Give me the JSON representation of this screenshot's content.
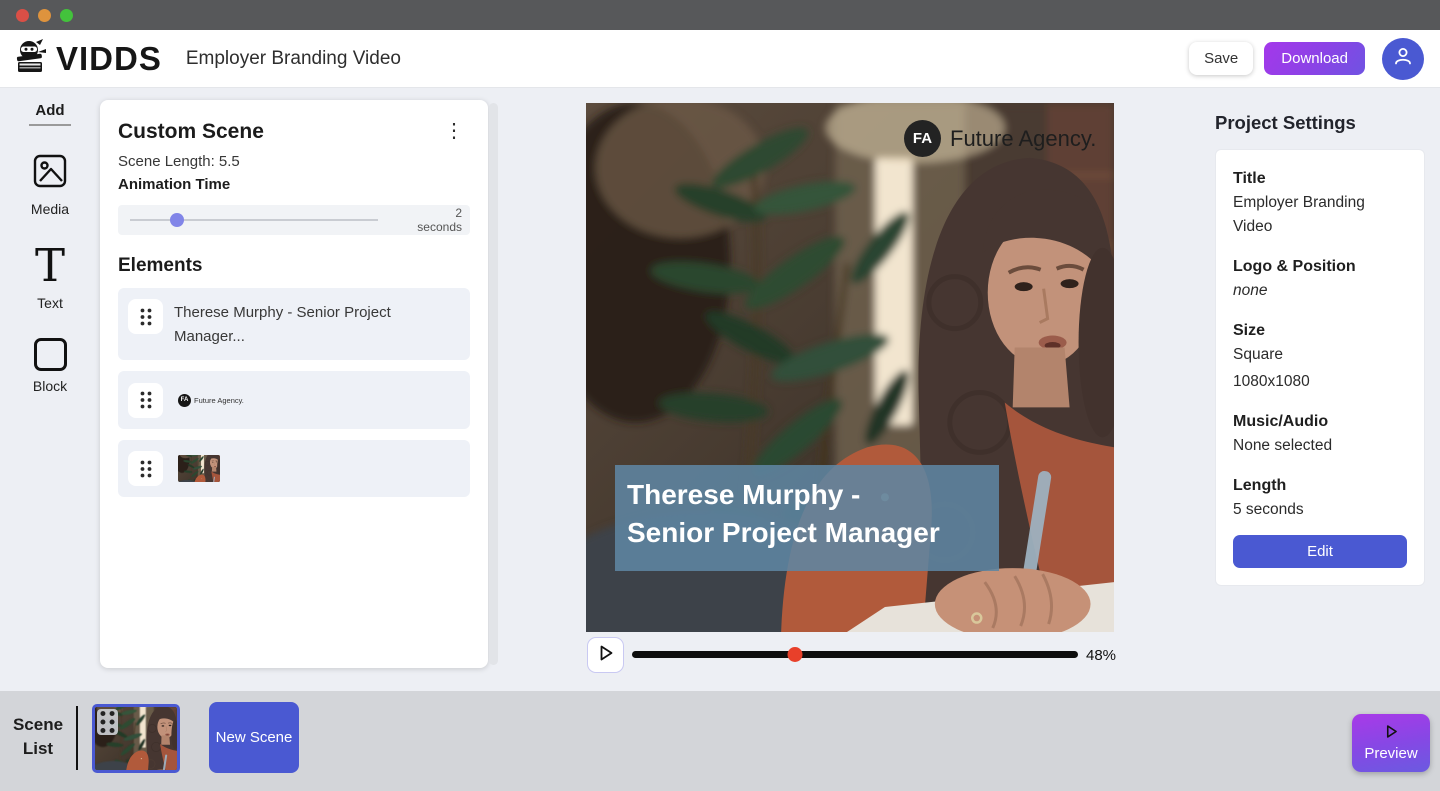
{
  "header": {
    "logo_text": "VIDDS",
    "project_title": "Employer Branding Video",
    "save_label": "Save",
    "download_label": "Download"
  },
  "toolbar": {
    "heading": "Add",
    "tools": [
      {
        "label": "Media"
      },
      {
        "label": "Text"
      },
      {
        "label": "Block"
      }
    ]
  },
  "scene_panel": {
    "title": "Custom Scene",
    "scene_length": "Scene Length: 5.5",
    "animation_time_label": "Animation Time",
    "slider": {
      "value": "2",
      "unit": "seconds",
      "thumb_percent": 19
    },
    "elements_heading": "Elements",
    "elements": [
      {
        "label": "Therese Murphy - Senior Project Manager..."
      },
      {
        "badge": "FA",
        "label": "Future Agency."
      },
      {
        "type": "video-thumbnail"
      }
    ]
  },
  "preview": {
    "watermark_badge": "FA",
    "watermark_text": "Future Agency.",
    "caption_line1": "Therese Murphy -",
    "caption_line2": "Senior Project Manager",
    "progress": {
      "percent_label": "48%",
      "dot_percent": 36.5
    }
  },
  "project_settings": {
    "heading": "Project Settings",
    "fields": [
      {
        "label": "Title",
        "value": "Employer Branding Video"
      },
      {
        "label": "Logo & Position",
        "value": "none"
      },
      {
        "label": "Size",
        "value": "Square",
        "value2": "1080x1080"
      },
      {
        "label": "Music/Audio",
        "value": "None selected"
      },
      {
        "label": "Length",
        "value": "5 seconds"
      }
    ],
    "edit_label": "Edit"
  },
  "scene_bar": {
    "heading": "Scene List",
    "new_scene_label": "New Scene",
    "preview_label": "Preview"
  },
  "icons": {
    "kebab": "⋮",
    "text_tool": "T"
  },
  "colors": {
    "accent_indigo": "#4a59d2",
    "purple_gradient_start": "#a438ea",
    "purple_gradient_end": "#6f53e2",
    "caption_overlay": "#5f85a2",
    "progress_dot": "#e8402a",
    "scrubber": "#0e0e0e"
  }
}
